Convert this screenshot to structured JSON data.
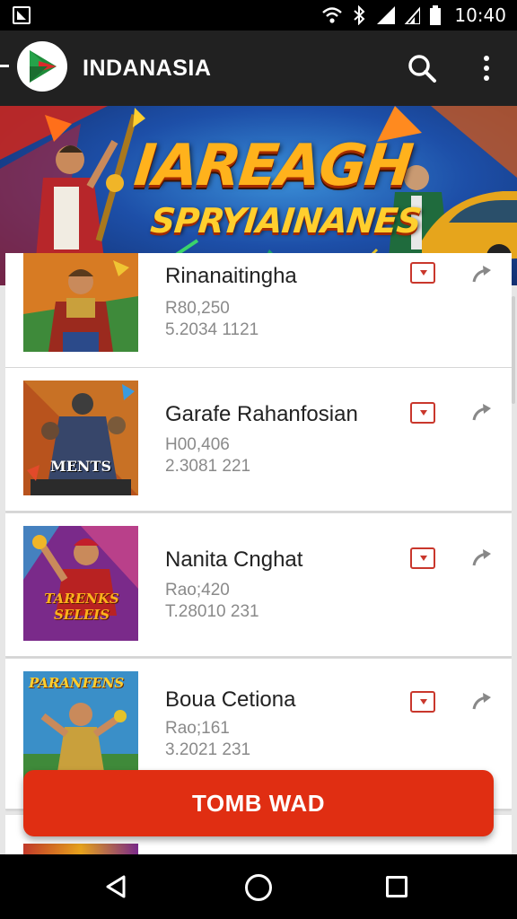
{
  "status_bar": {
    "time": "10:40"
  },
  "app_bar": {
    "title": "INDANASIA"
  },
  "banner": {
    "title": "IAREAGH",
    "subtitle": "SPRYIAINANES"
  },
  "games": [
    {
      "title": "Rinanaitingha",
      "meta1": "R80,250",
      "meta2": "5.2034 1121"
    },
    {
      "title": "Garafe Rahanfosian",
      "meta1": "H00,406",
      "meta2": "2.3081 221",
      "thumb_text": "MENTS"
    },
    {
      "title": "Nanita Cnghat",
      "meta1": "Rao;420",
      "meta2": "T.28010 231",
      "thumb_text": "TARENKS SELEIS"
    },
    {
      "title": "Boua Cetiona",
      "meta1": "Rao;161",
      "meta2": "3.2021 231",
      "thumb_text": "PARANFENS"
    }
  ],
  "cta": {
    "label": "TOMB WAD"
  },
  "colors": {
    "accent": "#e02e12",
    "app_bar": "#212121",
    "icon_red": "#c9372c"
  },
  "icons": [
    "notification-icon",
    "wifi-icon",
    "bluetooth-icon",
    "signal-icon",
    "battery-icon",
    "search-icon",
    "more-vert-icon",
    "play-store-icon",
    "share-icon",
    "nav-back-icon",
    "nav-home-icon",
    "nav-recents-icon"
  ]
}
